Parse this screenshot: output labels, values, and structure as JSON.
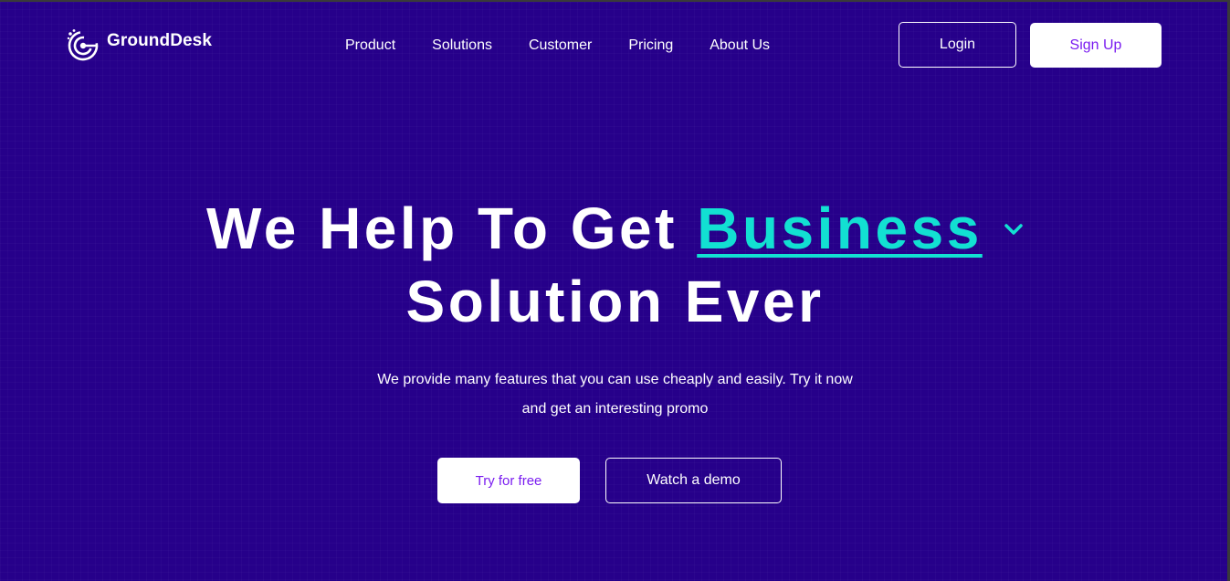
{
  "brand": {
    "name": "GroundDesk",
    "logo_icon": "grounddesk-logo-icon"
  },
  "nav": {
    "items": [
      {
        "label": "Product"
      },
      {
        "label": "Solutions"
      },
      {
        "label": "Customer"
      },
      {
        "label": "Pricing"
      },
      {
        "label": "About Us"
      }
    ]
  },
  "auth": {
    "login_label": "Login",
    "signup_label": "Sign Up"
  },
  "hero": {
    "title_prefix": "We Help To Get",
    "rotating_word": "Business",
    "title_suffix": "Solution Ever",
    "dropdown_icon": "chevron-down-icon",
    "subtitle_line_1": "We provide many features that you can use cheaply and easily. Try it now",
    "subtitle_line_2": "and get an interesting promo",
    "primary_cta": "Try for free",
    "secondary_cta": "Watch a demo"
  },
  "colors": {
    "background": "#26008a",
    "accent": "#12e0d2",
    "button_text": "#7a1cf0",
    "white": "#ffffff"
  }
}
